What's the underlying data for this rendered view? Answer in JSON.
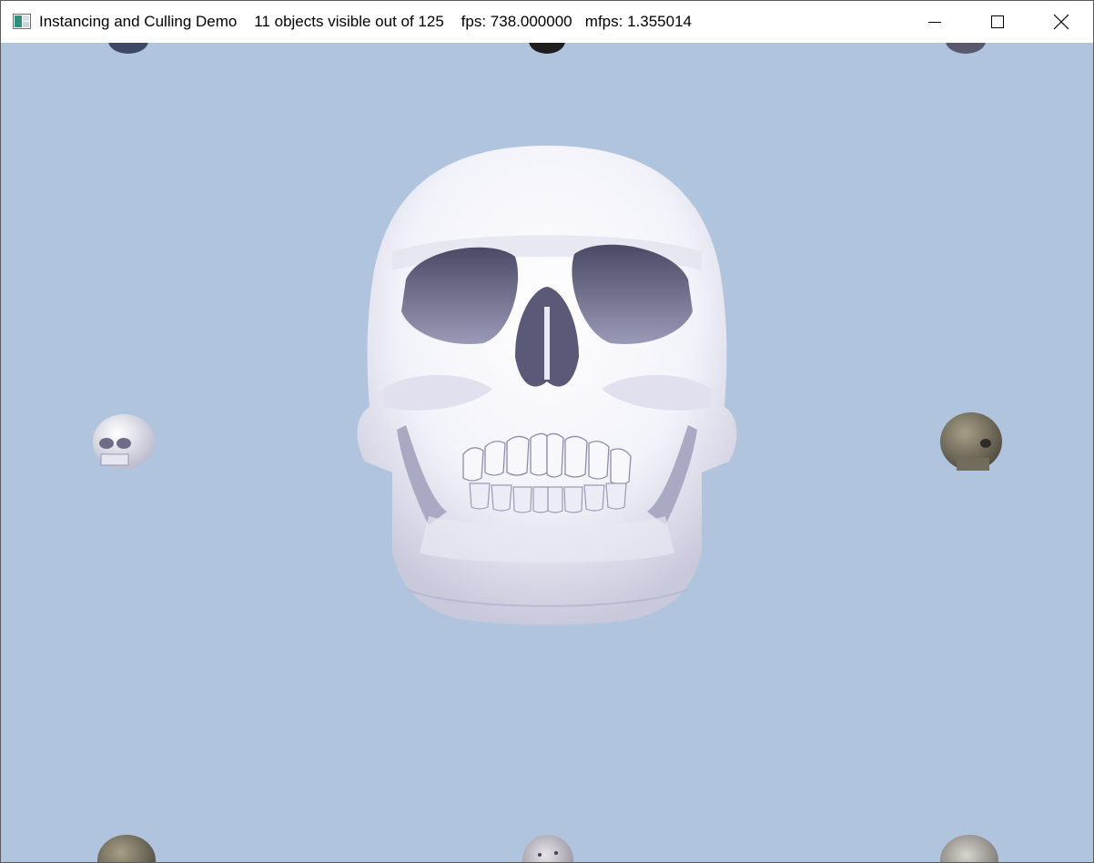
{
  "window": {
    "title": "Instancing and Culling Demo    11 objects visible out of 125    fps: 738.000000   mfps: 1.355014",
    "controls": {
      "minimize_icon": "minimize-icon",
      "maximize_icon": "maximize-icon",
      "close_icon": "close-icon"
    }
  },
  "viewport": {
    "background_color": "#b0c4de",
    "objects": [
      {
        "kind": "skull",
        "material": "white-shaded"
      },
      {
        "kind": "skull",
        "material": "white-shaded"
      },
      {
        "kind": "skull",
        "material": "stone-textured"
      },
      {
        "kind": "skull",
        "material": "stone-textured"
      },
      {
        "kind": "skull",
        "material": "pale-textured"
      },
      {
        "kind": "skull",
        "material": "metallic"
      },
      {
        "kind": "skull",
        "material": "dark-blue"
      },
      {
        "kind": "skull",
        "material": "dark"
      },
      {
        "kind": "skull",
        "material": "dark-blue"
      }
    ]
  }
}
